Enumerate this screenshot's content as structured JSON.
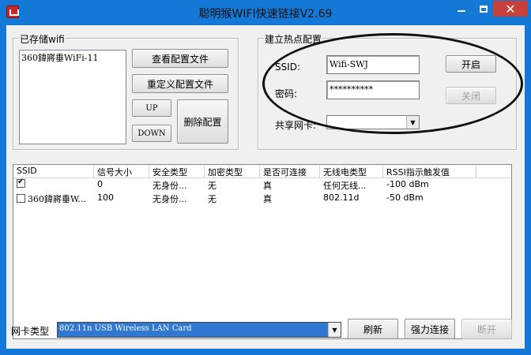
{
  "window": {
    "title": "聪明猴WIFI快速链接V2.69"
  },
  "saved": {
    "group_label": "已存储wifi",
    "items": [
      "360鍏嶈垂WiFi-11"
    ],
    "view_button": "查看配置文件",
    "redefine_button": "重定义配置文件",
    "up_button": "UP",
    "down_button": "DOWN",
    "delete_button": "删除配置"
  },
  "hotspot": {
    "group_label": "建立热点配置",
    "ssid_label": "SSID:",
    "ssid_value": "Wifi-SWJ",
    "password_label": "密码:",
    "password_value": "**********",
    "share_label": "共享网卡:",
    "share_value": "",
    "start_button": "开启",
    "close_button": "关闭"
  },
  "table": {
    "columns": [
      "SSID",
      "信号大小",
      "安全类型",
      "加密类型",
      "是否可连接",
      "无线电类型",
      "RSSI指示触发值"
    ],
    "rows": [
      {
        "checked": true,
        "ssid": "",
        "signal": "0",
        "security": "无身份...",
        "encryption": "无",
        "connectable": "真",
        "radio": "任何无线...",
        "rssi": "-100 dBm"
      },
      {
        "checked": false,
        "ssid": "360鍏嶈垂W...",
        "signal": "100",
        "security": "无身份...",
        "encryption": "无",
        "connectable": "真",
        "radio": "802.11d",
        "rssi": "-50 dBm"
      }
    ]
  },
  "footer": {
    "adapter_label": "网卡类型",
    "adapter_value": "802.11n USB Wireless LAN Card",
    "refresh_button": "刷新",
    "force_connect_button": "强力连接",
    "disconnect_button": "断开"
  }
}
